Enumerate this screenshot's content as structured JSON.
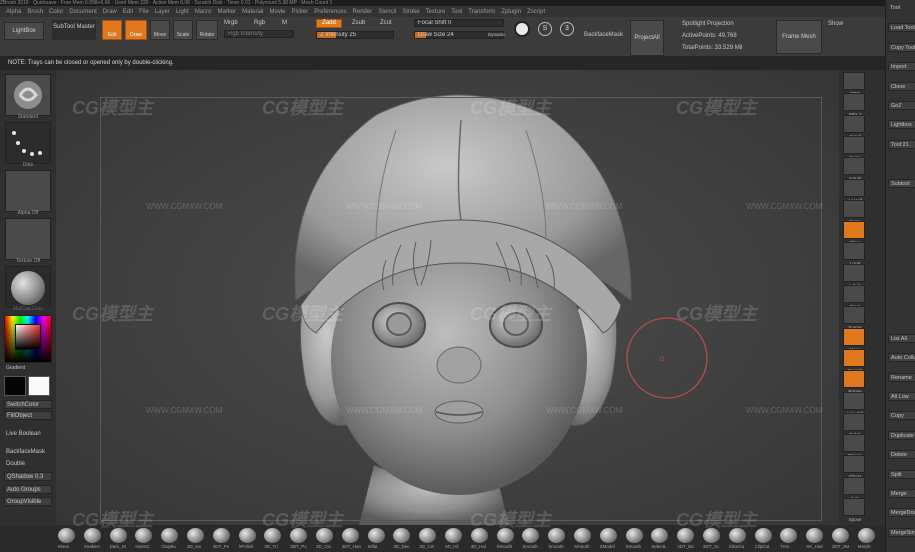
{
  "app": {
    "title_strip": "ZBrush 2018 · Quicksave · Free Mem 6.098+6.66 · Used Mem 220 · Active Mem 6.08 · Scratch Disk · Timer 0.01 · Polycount 5.38 MP · Mesh Count 1"
  },
  "menu": [
    "Alpha",
    "Brush",
    "Color",
    "Document",
    "Draw",
    "Edit",
    "File",
    "Layer",
    "Light",
    "Macro",
    "Marker",
    "Material",
    "Movie",
    "Picker",
    "Preferences",
    "Render",
    "Stencil",
    "Stroke",
    "Texture",
    "Tool",
    "Transform",
    "Zplugin",
    "Zscript"
  ],
  "toolbar": {
    "lightbox": "LightBox",
    "subtool_master": "SubTool Master",
    "edit": "Edit",
    "draw": "Draw",
    "move": "Move",
    "scale": "Scale",
    "rotate": "Rotate",
    "mrgb": "Mrgb",
    "rgb": "Rgb",
    "m": "M",
    "rgb_intensity": "Rgb Intensity",
    "zadd": "Zadd",
    "zsub": "Zsub",
    "zcut": "Zcut",
    "z_intensity_label": "Z Intensity",
    "z_intensity_value": "25",
    "z_intensity_fraction": 0.25,
    "focal_shift_label": "Focal Shift",
    "focal_shift_value": "0",
    "draw_size_label": "Draw Size",
    "draw_size_value": "24",
    "draw_size_fraction": 0.12,
    "dynamic": "Dynamic",
    "backface_mask": "BackfaceMask",
    "project_all": "ProjectAll",
    "spotlight_projection": "Spotlight Projection",
    "active_points": "ActivePoints: 49,768",
    "total_points": "TotalPoints: 33.529 Mil",
    "frame_mesh": "Frame Mesh",
    "show": "Show"
  },
  "note": "NOTE: Trays can be closed or opened only by double-clicking.",
  "left_shelf": {
    "standard": "Standard",
    "dots": "Dots",
    "alpha_off": "Alpha Off",
    "texture_off": "Texture Off",
    "material": "MatCap Gray",
    "gradient": "Gradient",
    "switch_color": "SwitchColor",
    "fill_object": "FillObject",
    "live_boolean": "Live Boolean",
    "backface_mask": "BackfaceMask",
    "double": "Double",
    "qshadow": "QShadow 0.3",
    "auto_groups": "Auto Groups",
    "group_visible": "GroupVisible"
  },
  "right_shelf": [
    "BPR",
    "SPix 3",
    "Scroll",
    "Zoom",
    "Actual",
    "AAHalf",
    "Persp",
    "Floor",
    "Local",
    "L.Sym",
    "Gxyz",
    "Frame",
    "Move",
    "ZoomD",
    "Rotate",
    "Line Fill",
    "PolyF",
    "Transp",
    "Ghost",
    "Solo",
    "Xpose"
  ],
  "tool_panel": [
    "Tool",
    "Load Tool",
    "Copy Tool",
    "Import",
    "Clone",
    "GoZ",
    "Lightbox",
    "Tool:21",
    "",
    "Subtool",
    "",
    "",
    "",
    "",
    "",
    "",
    "",
    "List All",
    "Auto Collapse",
    "Rename",
    "All Low",
    "Copy",
    "Duplicate",
    "Delete",
    "Split",
    "Merge",
    "MergeDown",
    "MergeSim"
  ],
  "bottom_shelf": [
    "Move",
    "SnakeH",
    "Dam_St",
    "InsertC",
    "ClayBu",
    "3D_sto",
    "3DT_Ps",
    "hPolish",
    "3D_Tri",
    "3DT_Po",
    "3D_Clo",
    "3DT_Han",
    "Inflat",
    "3D_Dec",
    "3D_Cel",
    "3D_Hil",
    "3D_Hal",
    "Smooth",
    "Smooth",
    "Smooth",
    "Smooth",
    "ZModel",
    "Smooth",
    "SelectL",
    "3DT_Ba",
    "3DT_Sc",
    "SliceCu",
    "ClipCut",
    "Trim",
    "SK_Hair",
    "3DT_3M",
    "Morph"
  ],
  "watermarks": {
    "brand": "CG模型主",
    "url": "WWW.CGMXW.COM"
  }
}
